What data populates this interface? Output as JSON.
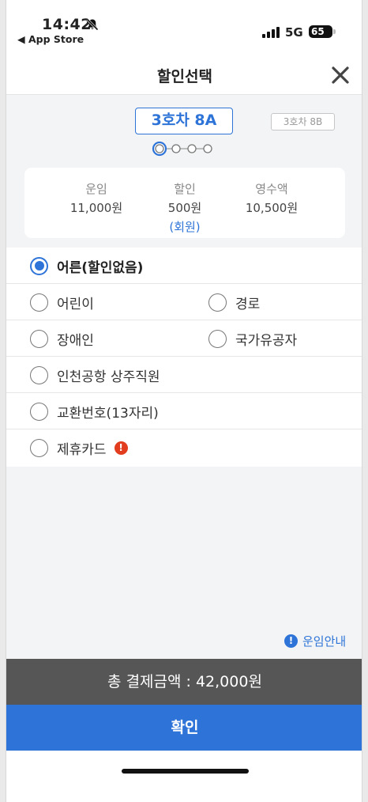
{
  "status_bar": {
    "time": "14:42",
    "back_app": "◀ App Store",
    "network": "5G",
    "battery": "65"
  },
  "header": {
    "title": "할인선택"
  },
  "car_selector": {
    "selected": "3호차 8A",
    "other": "3호차 8B",
    "page_count": 4,
    "current_page": 1
  },
  "summary": {
    "fare_label": "운임",
    "fare_value": "11,000원",
    "discount_label": "할인",
    "discount_value": "500원",
    "discount_note": "(회원)",
    "receipt_label": "영수액",
    "receipt_value": "10,500원"
  },
  "options": {
    "adult": "어른(할인없음)",
    "child": "어린이",
    "senior": "경로",
    "disabled": "장애인",
    "veteran": "국가유공자",
    "airport_staff": "인천공항 상주직원",
    "exchange_no": "교환번호(13자리)",
    "partner_card": "제휴카드",
    "selected": "adult"
  },
  "fare_info": {
    "icon": "!",
    "label": "운임안내"
  },
  "total": {
    "text": "총 결제금액 : 42,000원"
  },
  "confirm": {
    "label": "확인"
  },
  "colors": {
    "accent": "#2e74d8",
    "warning": "#e23d1e",
    "total_bar": "#565656"
  }
}
